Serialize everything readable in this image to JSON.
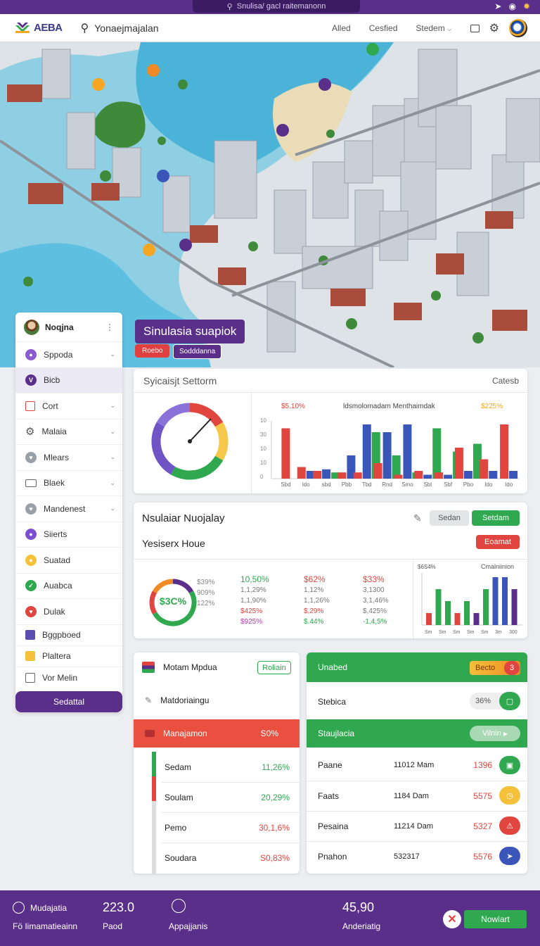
{
  "system": {
    "url": "Snulisa/ gacl raitemanonn"
  },
  "header": {
    "logo": "AEBA",
    "search_text": "Yonaejmajalan",
    "nav": [
      "Alled",
      "Cesfied",
      "Stedem"
    ]
  },
  "colors": {
    "purple": "#5a2f8a",
    "green": "#2fa84f",
    "red": "#e0463f",
    "blue": "#3a56b8",
    "orange": "#f5a623"
  },
  "overlay": {
    "title": "Sinulasia suapiok",
    "tag1": "Roebo",
    "tag2": "Sodddanna"
  },
  "sidebar": {
    "user": "Noqjna",
    "items": [
      {
        "label": "Sppoda",
        "icon": "pin-icon",
        "chev": true
      },
      {
        "label": "Bicb",
        "icon": "v-icon",
        "chev": false
      },
      {
        "label": "Cort",
        "icon": "folder-icon",
        "chev": true
      },
      {
        "label": "Malaia",
        "icon": "gear-icon",
        "chev": true
      },
      {
        "label": "Mlears",
        "icon": "heart-icon",
        "chev": true
      },
      {
        "label": "Blaek",
        "icon": "bus-icon",
        "chev": true
      },
      {
        "label": "Mandenest",
        "icon": "heart-icon",
        "chev": true
      },
      {
        "label": "Siierts",
        "icon": "chart-icon",
        "chev": false
      },
      {
        "label": "Suatad",
        "icon": "shield-icon",
        "chev": false
      },
      {
        "label": "Auabca",
        "icon": "check-icon",
        "chev": false
      },
      {
        "label": "Dulak",
        "icon": "heart-icon",
        "chev": false
      },
      {
        "label": "Bggpboed",
        "icon": "clipboard-icon",
        "chev": false
      },
      {
        "label": "Plaltera",
        "icon": "note-icon",
        "chev": false
      },
      {
        "label": "Vor Melin",
        "icon": "checkbox-icon",
        "chev": false
      }
    ],
    "button": "Sedattal"
  },
  "card1": {
    "title": "Syicaisjt  Settorm",
    "action": "Catesb"
  },
  "chart_data": {
    "type": "bar",
    "title": "ldsmolomadam Menthaimdak",
    "left_label": "$5.10%",
    "right_label": "$225%",
    "yticks": [
      "10",
      "30",
      "10",
      "10",
      "0"
    ],
    "categories": [
      "Sbd",
      "ldo",
      "sbd",
      "Pbb",
      "Tbd",
      "Rnd",
      "Smo",
      "Sbl",
      "Sbf",
      "Pbo",
      "Ido",
      "Ido"
    ],
    "series": [
      {
        "color": "#e0463f",
        "values": [
          6.5,
          1.5,
          1.0,
          0.8,
          0.8,
          2.0,
          0.5,
          1.0,
          0.8,
          4.0,
          2.5,
          7.0
        ]
      },
      {
        "color": "#3a56b8",
        "values": [
          0,
          1.0,
          1.2,
          3.0,
          7.0,
          6.0,
          7.0,
          0.5,
          0.5,
          1.0,
          1.0,
          1.0
        ]
      },
      {
        "color": "#2fa84f",
        "values": [
          0,
          0,
          0.8,
          0,
          6.0,
          3.0,
          0.8,
          6.5,
          3.5,
          4.5,
          0,
          0
        ]
      }
    ]
  },
  "card2": {
    "title": "Nsulaiar Nuojalay",
    "subtitle": "Yesiserx Houe",
    "btn_grey": "Sedan",
    "btn_green": "Setdam",
    "btn_red": "Eoamat",
    "donut_value": "$3C%",
    "donut_labels": [
      "$39%",
      "909%",
      "122%"
    ],
    "col_green": [
      "10,50%",
      "1,1,29%",
      "1,1,90%",
      "$425%",
      "$925%"
    ],
    "col_red": [
      "$62%",
      "1,12%",
      "1,1,26%",
      "$,29%",
      "$.44%"
    ],
    "col_dark": [
      "$33%",
      "3,1300",
      "3,1,46%",
      "$,425%",
      "-1,4,5%"
    ],
    "mini_title_left": "$6S4%",
    "mini_title_right": "Cmalniinion",
    "mini_values": [
      1,
      3,
      2,
      1,
      2,
      1,
      3,
      4,
      4,
      3
    ],
    "mini_labels": [
      "Sm",
      "Sm",
      "Sm",
      "Sm",
      "Sm",
      "3m",
      "300"
    ]
  },
  "card3": {
    "title": "Motam Mpdua",
    "badge": "Roliain",
    "row2": "Matdoriaingu",
    "banner": "Manajamon",
    "banner_value": "S0%",
    "rows": [
      {
        "label": "Sedam",
        "value": "11,26%"
      },
      {
        "label": "Soulam",
        "value": "20,29%"
      },
      {
        "label": "Pemo",
        "value": "30,1,6%"
      },
      {
        "label": "Soudara",
        "value": "S0,83%"
      }
    ]
  },
  "card4": {
    "title": "Unabed",
    "badge": "Becto",
    "badge_count": "3",
    "row2": "Stebica",
    "row2_value": "36%",
    "banner": "Staujlacia",
    "banner_btn": "Vilnin",
    "rows": [
      {
        "label": "Paane",
        "time": "11012 Mam",
        "value": "1396"
      },
      {
        "label": "Faats",
        "time": "1184 Dam",
        "value": "5575"
      },
      {
        "label": "Pesaina",
        "time": "11214 Dam",
        "value": "5327"
      },
      {
        "label": "Pnahon",
        "time": "532317",
        "value": "5576"
      }
    ]
  },
  "footer": {
    "label1": "Mudajatia",
    "label2": "Fö Iimamatieainn",
    "value1": "223.0",
    "value1_sub": "Paod",
    "label3": "Appajjanis",
    "value2": "45,90",
    "value2_sub": "Anderiatig",
    "button": "Nowlart"
  }
}
